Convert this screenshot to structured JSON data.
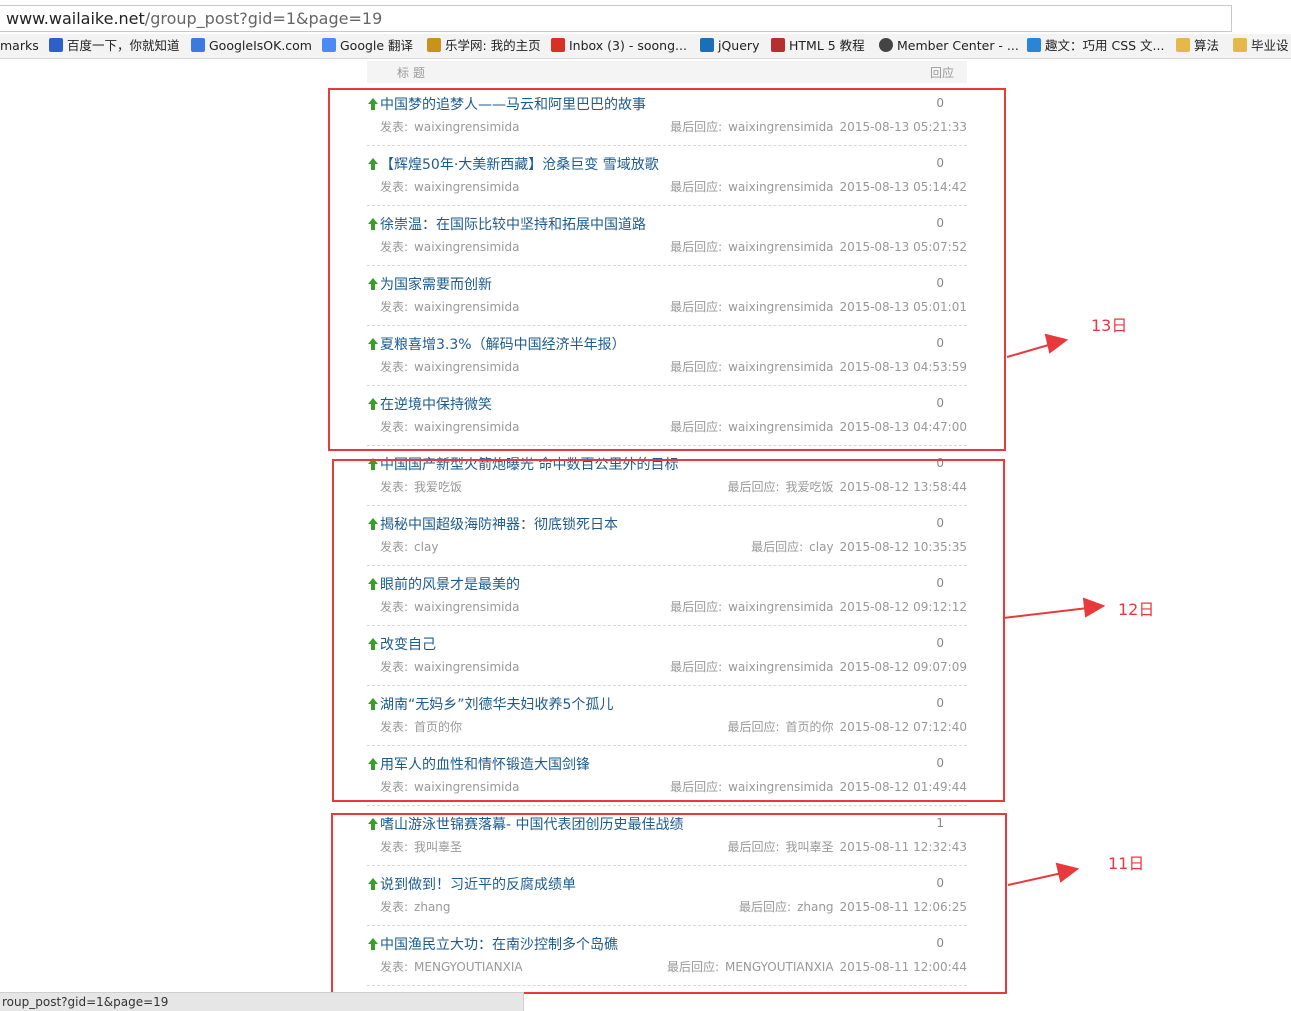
{
  "browser": {
    "url_host": "www.wailaike.net",
    "url_path": "/group_post?gid=1&page=19",
    "status_text": "roup_post?gid=1&page=19"
  },
  "bookmarks": [
    {
      "label": "marks",
      "icon": "bookmarks-folder-icon",
      "color": "#f3f3f3"
    },
    {
      "label": "百度一下，你就知道",
      "icon": "baidu-paw-icon",
      "color": "#2f5fc8"
    },
    {
      "label": "GoogleIsOK.com",
      "icon": "google-g-icon",
      "color": "#3b7be0"
    },
    {
      "label": "Google 翻译",
      "icon": "google-translate-icon",
      "color": "#4a8af4"
    },
    {
      "label": "乐学网: 我的主页",
      "icon": "lexue-icon",
      "color": "#c8931c"
    },
    {
      "label": "Inbox (3) - soong...",
      "icon": "gmail-icon",
      "color": "#d93025"
    },
    {
      "label": "jQuery",
      "icon": "jquery-icon",
      "color": "#1b6fb8"
    },
    {
      "label": "HTML 5 教程",
      "icon": "w3school-icon",
      "color": "#b52f2f"
    },
    {
      "label": "Member Center - ...",
      "icon": "apple-icon",
      "color": "#444444"
    },
    {
      "label": "趣文：巧用 CSS 文...",
      "icon": "b-site-icon",
      "color": "#2a85d8"
    },
    {
      "label": "算法",
      "icon": "folder-icon",
      "color": "#e4b84a"
    },
    {
      "label": "毕业设",
      "icon": "folder-icon",
      "color": "#e4b84a"
    }
  ],
  "table_header": {
    "title_col": "标题",
    "replies_col": "回应"
  },
  "labels": {
    "author_prefix": "发表:",
    "last_reply_prefix": "最后回应:"
  },
  "posts": [
    {
      "title": "中国梦的追梦人——马云和阿里巴巴的故事",
      "replies": "0",
      "author": "waixingrensimida",
      "last_user": "waixingrensimida",
      "last_time": "2015-08-13 05:21:33"
    },
    {
      "title": "【辉煌50年·大美新西藏】沧桑巨变 雪域放歌",
      "replies": "0",
      "author": "waixingrensimida",
      "last_user": "waixingrensimida",
      "last_time": "2015-08-13 05:14:42"
    },
    {
      "title": "徐崇温：在国际比较中坚持和拓展中国道路",
      "replies": "0",
      "author": "waixingrensimida",
      "last_user": "waixingrensimida",
      "last_time": "2015-08-13 05:07:52"
    },
    {
      "title": "为国家需要而创新",
      "replies": "0",
      "author": "waixingrensimida",
      "last_user": "waixingrensimida",
      "last_time": "2015-08-13 05:01:01"
    },
    {
      "title": "夏粮喜增3.3%（解码中国经济半年报）",
      "replies": "0",
      "author": "waixingrensimida",
      "last_user": "waixingrensimida",
      "last_time": "2015-08-13 04:53:59"
    },
    {
      "title": "在逆境中保持微笑",
      "replies": "0",
      "author": "waixingrensimida",
      "last_user": "waixingrensimida",
      "last_time": "2015-08-13 04:47:00"
    },
    {
      "title": "中国国产新型火箭炮曝光 命中数百公里外的目标",
      "replies": "0",
      "author": "我爱吃饭",
      "last_user": "我爱吃饭",
      "last_time": "2015-08-12 13:58:44"
    },
    {
      "title": "揭秘中国超级海防神器：彻底锁死日本",
      "replies": "0",
      "author": "clay",
      "last_user": "clay",
      "last_time": "2015-08-12 10:35:35"
    },
    {
      "title": "眼前的风景才是最美的",
      "replies": "0",
      "author": "waixingrensimida",
      "last_user": "waixingrensimida",
      "last_time": "2015-08-12 09:12:12"
    },
    {
      "title": "改变自己",
      "replies": "0",
      "author": "waixingrensimida",
      "last_user": "waixingrensimida",
      "last_time": "2015-08-12 09:07:09"
    },
    {
      "title": "湖南“无妈乡”刘德华夫妇收养5个孤儿",
      "replies": "0",
      "author": "首页的你",
      "last_user": "首页的你",
      "last_time": "2015-08-12 07:12:40"
    },
    {
      "title": "用军人的血性和情怀锻造大国剑锋",
      "replies": "0",
      "author": "waixingrensimida",
      "last_user": "waixingrensimida",
      "last_time": "2015-08-12 01:49:44"
    },
    {
      "title": "嗜山游泳世锦赛落幕- 中国代表团创历史最佳战绩",
      "replies": "1",
      "author": "我叫辜圣",
      "last_user": "我叫辜圣",
      "last_time": "2015-08-11 12:32:43"
    },
    {
      "title": "说到做到！习近平的反腐成绩单",
      "replies": "0",
      "author": "zhang",
      "last_user": "zhang",
      "last_time": "2015-08-11 12:06:25"
    },
    {
      "title": "中国渔民立大功：在南沙控制多个岛礁",
      "replies": "0",
      "author": "MENGYOUTIANXIA",
      "last_user": "MENGYOUTIANXIA",
      "last_time": "2015-08-11 12:00:44"
    }
  ],
  "annotations": [
    {
      "label": "13日",
      "color": "#e8393d"
    },
    {
      "label": "12日",
      "color": "#e8393d"
    },
    {
      "label": "11日",
      "color": "#e8393d"
    }
  ]
}
